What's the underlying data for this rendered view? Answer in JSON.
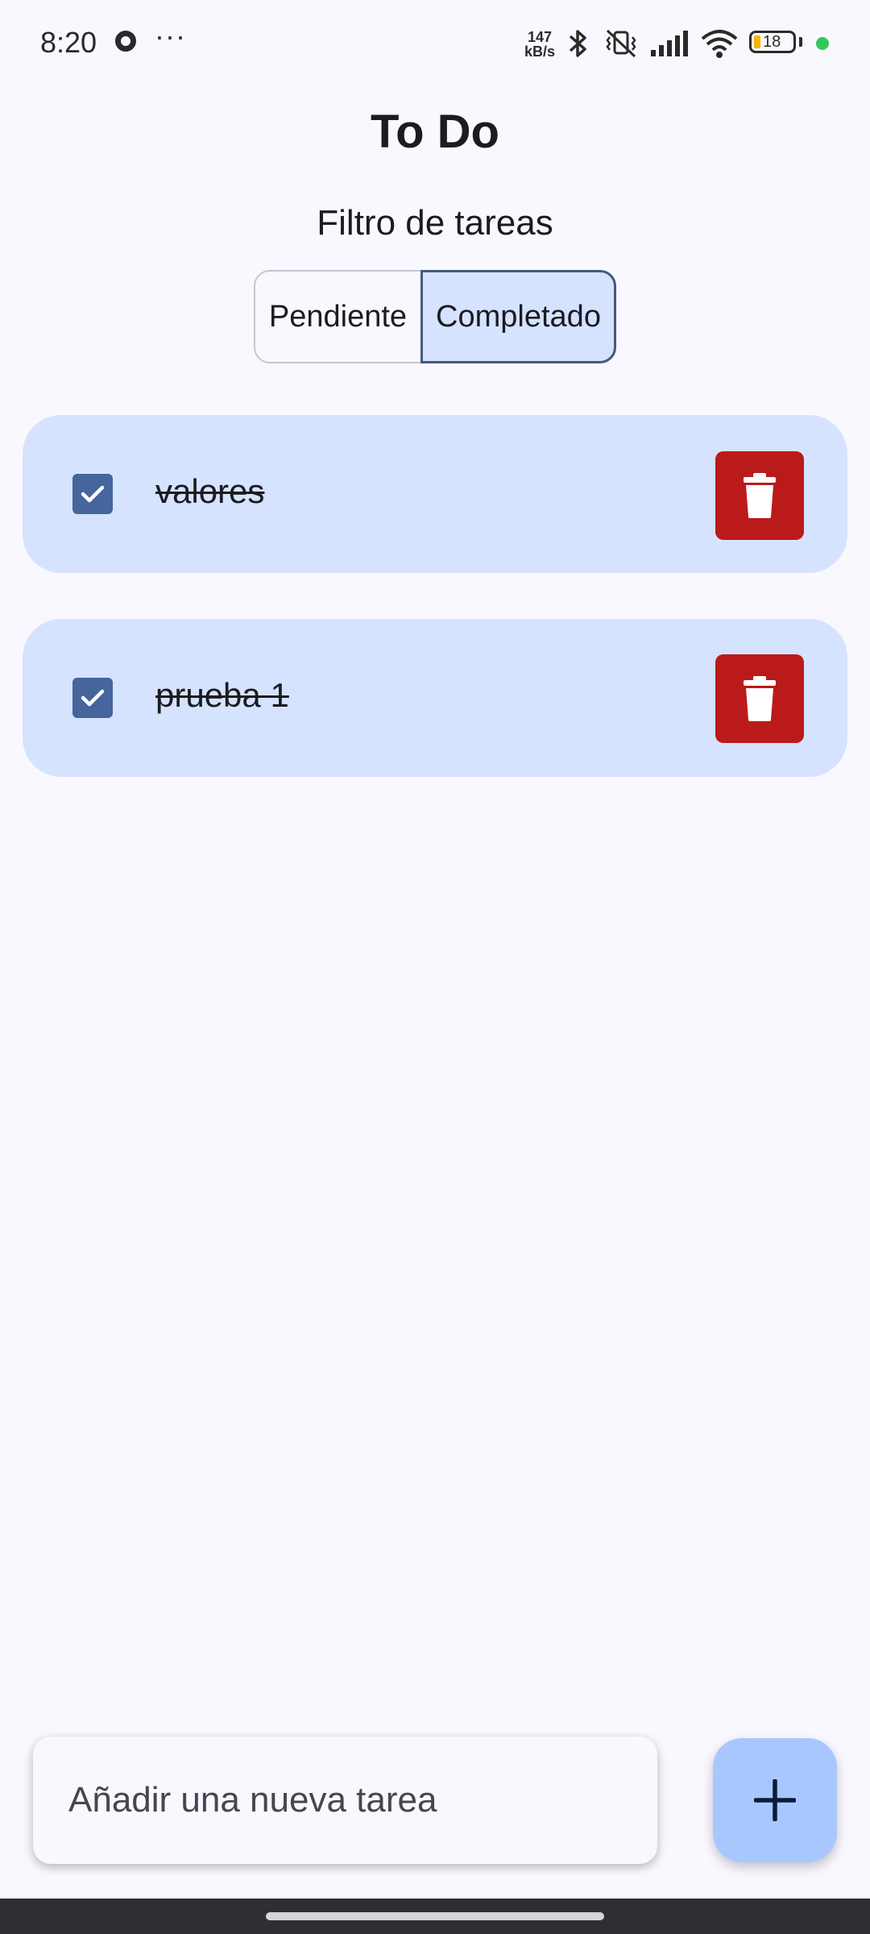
{
  "status_bar": {
    "time": "8:20",
    "dots": "···",
    "speed_value": "147",
    "speed_unit": "kB/s",
    "battery": "18",
    "icons": [
      "record-icon",
      "bluetooth-icon",
      "vibrate-icon",
      "signal-icon",
      "wifi-icon",
      "battery-icon"
    ]
  },
  "app": {
    "title": "To Do",
    "filter_label": "Filtro de tareas"
  },
  "filter": {
    "options": [
      "Pendiente",
      "Completado"
    ],
    "selected": "Completado"
  },
  "tasks": [
    {
      "text": "valores",
      "completed": true
    },
    {
      "text": "prueba 1",
      "completed": true
    }
  ],
  "new_task": {
    "placeholder": "Añadir una nueva tarea",
    "value": ""
  },
  "colors": {
    "background": "#f9f8fe",
    "card": "#d6e3ff",
    "checkbox": "#45659c",
    "delete": "#bb1a1a",
    "fab": "#a9c7ff",
    "segment_selected": "#d6e3ff"
  }
}
